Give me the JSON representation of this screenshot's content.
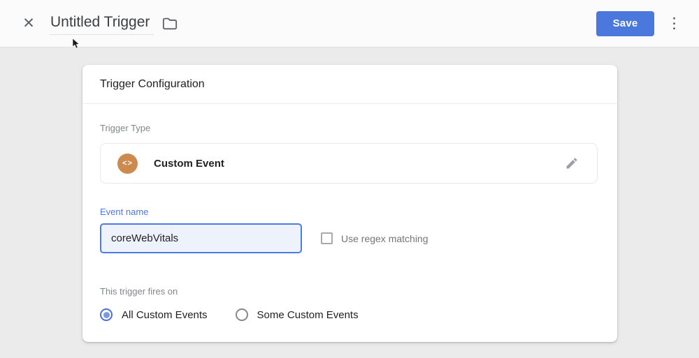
{
  "header": {
    "close_glyph": "✕",
    "title": "Untitled Trigger",
    "save_label": "Save",
    "more_glyph": "⋮"
  },
  "card": {
    "title": "Trigger Configuration",
    "trigger_type": {
      "label": "Trigger Type",
      "value": "Custom Event",
      "icon_glyph": "<>"
    },
    "event": {
      "label": "Event name",
      "value": "coreWebVitals",
      "regex_label": "Use regex matching",
      "regex_checked": false
    },
    "fires_on": {
      "label": "This trigger fires on",
      "options": [
        {
          "label": "All Custom Events",
          "selected": true
        },
        {
          "label": "Some Custom Events",
          "selected": false
        }
      ]
    }
  },
  "colors": {
    "save_button_blue": "#4b78dd",
    "input_border_blue": "#4c7be8",
    "label_blue": "#4d79e6",
    "icon_orange": "#cd8a4f",
    "radio_selected_blue": "#4b6fd6"
  }
}
